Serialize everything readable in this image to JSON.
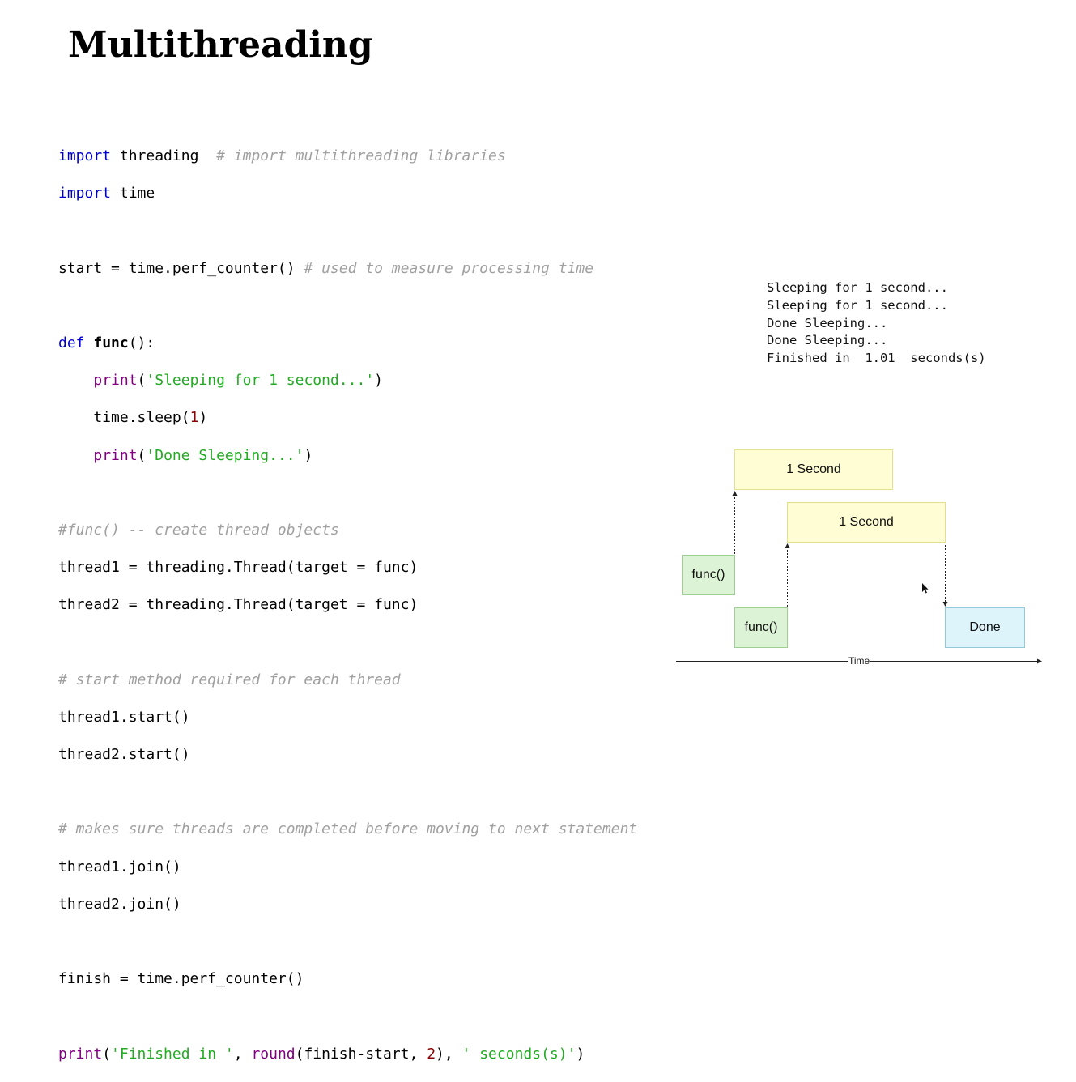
{
  "title": "Multithreading",
  "code": {
    "l1_kw": "import",
    "l1_mod": "threading",
    "l1_comment": "# import multithreading libraries",
    "l2_kw": "import",
    "l2_mod": "time",
    "l4_a": "start = time.perf_counter() ",
    "l4_comment": "# used to measure processing time",
    "l6_kw": "def",
    "l6_name": "func",
    "l6_rest": "():",
    "l7_indent": "    ",
    "l7_print": "print",
    "l7_open": "(",
    "l7_str": "'Sleeping for 1 second...'",
    "l7_close": ")",
    "l8_a": "    time.sleep(",
    "l8_num": "1",
    "l8_close": ")",
    "l9_indent": "    ",
    "l9_print": "print",
    "l9_open": "(",
    "l9_str": "'Done Sleeping...'",
    "l9_close": ")",
    "l11_comment": "#func() -- create thread objects",
    "l12": "thread1 = threading.Thread(target = func)",
    "l13": "thread2 = threading.Thread(target = func)",
    "l15_comment": "# start method required for each thread",
    "l16": "thread1.start()",
    "l17": "thread2.start()",
    "l19_comment": "# makes sure threads are completed before moving to next statement",
    "l20": "thread1.join()",
    "l21": "thread2.join()",
    "l23": "finish = time.perf_counter()",
    "l25_print": "print",
    "l25_open": "(",
    "l25_str1": "'Finished in '",
    "l25_sep1": ", ",
    "l25_round": "round",
    "l25_args": "(finish-start, ",
    "l25_num": "2",
    "l25_sep2": "), ",
    "l25_str2": "' seconds(s)'",
    "l25_close": ")"
  },
  "output": {
    "lines": [
      "Sleeping for 1 second...",
      "Sleeping for 1 second...",
      "Done Sleeping...",
      "Done Sleeping...",
      "Finished in  1.01  seconds(s)"
    ]
  },
  "diagram": {
    "second_box_1": "1 Second",
    "second_box_2": "1 Second",
    "func_box_1": "func()",
    "func_box_2": "func()",
    "done_box": "Done",
    "time_axis_label": "Time",
    "colors": {
      "second": "#fffdd4",
      "func": "#dcf3d6",
      "done": "#def4fb"
    }
  }
}
